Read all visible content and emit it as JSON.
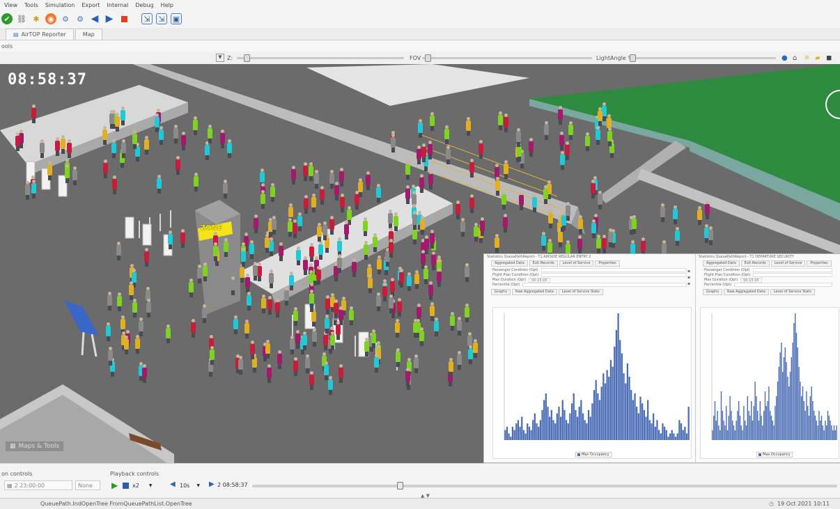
{
  "menu": [
    "View",
    "Tools",
    "Simulation",
    "Export",
    "Internal",
    "Debug",
    "Help"
  ],
  "tabs": [
    {
      "label": "AirTOP Reporter"
    },
    {
      "label": "Map"
    }
  ],
  "subrow_label": "ools",
  "view_controls": {
    "z_label": "Z:",
    "fov_label": "FOV",
    "light_label": "LightAngle °"
  },
  "scene": {
    "clock": "08:58:37",
    "zone_label": "ZONE",
    "maps_tools_label": "Maps & Tools"
  },
  "panel_left": {
    "header": "Statistics QueuePathReport - T1 AIRSIDE REGULAR ENTRY 2",
    "tabs": [
      "Aggregated Data",
      "Exit Records",
      "Level of Service",
      "Properties"
    ],
    "fields": [
      "Passenger Condition (Opt)",
      "Flight Plan Condition (Opt)",
      "Max Duration (Opt)",
      "Percentile (Opt)"
    ],
    "max_duration_value": "00:15:00",
    "chart_tabs": [
      "Graphs",
      "Raw Aggregated Data",
      "Level of Service Stats"
    ],
    "legend": "Max Occupancy"
  },
  "panel_right": {
    "header": "Statistics QueuePathReport - T1 DEPARTURE SECURITY",
    "tabs": [
      "Aggregated Data",
      "Exit Records",
      "Level of Service",
      "Properties"
    ],
    "fields": [
      "Passenger Condition (Opt)",
      "Flight Plan Condition (Opt)",
      "Max Duration (Opt)",
      "Percentile (Opt)"
    ],
    "max_duration_value": "00:15:00",
    "chart_tabs": [
      "Graphs",
      "Raw Aggregated Data",
      "Level of Service Stats"
    ],
    "legend": "Max Occupancy"
  },
  "chart_data": [
    {
      "type": "bar",
      "series": [
        {
          "values": [
            3,
            4,
            2,
            1,
            4,
            3,
            5,
            6,
            4,
            7,
            3,
            2,
            5,
            4,
            3,
            6,
            8,
            5,
            4,
            6,
            9,
            12,
            14,
            10,
            7,
            9,
            6,
            5,
            8,
            10,
            7,
            12,
            9,
            6,
            5,
            8,
            11,
            14,
            9,
            7,
            10,
            12,
            8,
            6,
            5,
            9,
            7,
            11,
            15,
            18,
            14,
            12,
            16,
            20,
            17,
            21,
            19,
            24,
            22,
            28,
            33,
            38,
            30,
            26,
            20,
            17,
            23,
            19,
            15,
            12,
            14,
            10,
            8,
            13,
            11,
            9,
            7,
            12,
            6,
            5,
            8,
            4,
            6,
            3,
            2,
            5,
            4,
            3,
            1,
            2,
            3,
            2,
            1,
            2,
            6,
            5,
            3,
            4,
            2,
            10
          ]
        }
      ]
    },
    {
      "type": "bar",
      "series": [
        {
          "values": [
            2,
            5,
            8,
            4,
            6,
            3,
            2,
            10,
            6,
            4,
            3,
            7,
            2,
            5,
            9,
            6,
            4,
            3,
            2,
            4,
            6,
            8,
            5,
            3,
            2,
            7,
            4,
            3,
            9,
            6,
            5,
            8,
            4,
            7,
            12,
            9,
            6,
            4,
            8,
            5,
            3,
            6,
            10,
            7,
            8,
            11,
            6,
            5,
            4,
            3,
            7,
            9,
            12,
            15,
            18,
            20,
            14,
            17,
            19,
            16,
            13,
            11,
            14,
            17,
            20,
            24,
            26,
            22,
            19,
            15,
            12,
            9,
            11,
            8,
            6,
            10,
            7,
            5,
            9,
            11,
            8,
            6,
            5,
            4,
            3,
            6,
            4,
            5,
            3,
            2,
            4,
            3,
            6,
            5,
            4,
            3,
            2,
            3,
            2,
            3
          ]
        }
      ]
    }
  ],
  "playback": {
    "left_label": "on controls",
    "label": "Playback controls",
    "start_time": "2 23:00:00",
    "mode": "None",
    "speed": "x2",
    "step": "10s",
    "current_time": "2 08:58:37"
  },
  "status": {
    "message": "QueuePath.IndOpenTree FromQueuePathList.OpenTree",
    "date": "19 Oct 2021 10:11"
  },
  "colors": {
    "bar": "#4a6db5",
    "scene_floor": "#6b6b6b",
    "field_green": "#2d8a3e",
    "zone_yellow": "#f5e31a"
  }
}
